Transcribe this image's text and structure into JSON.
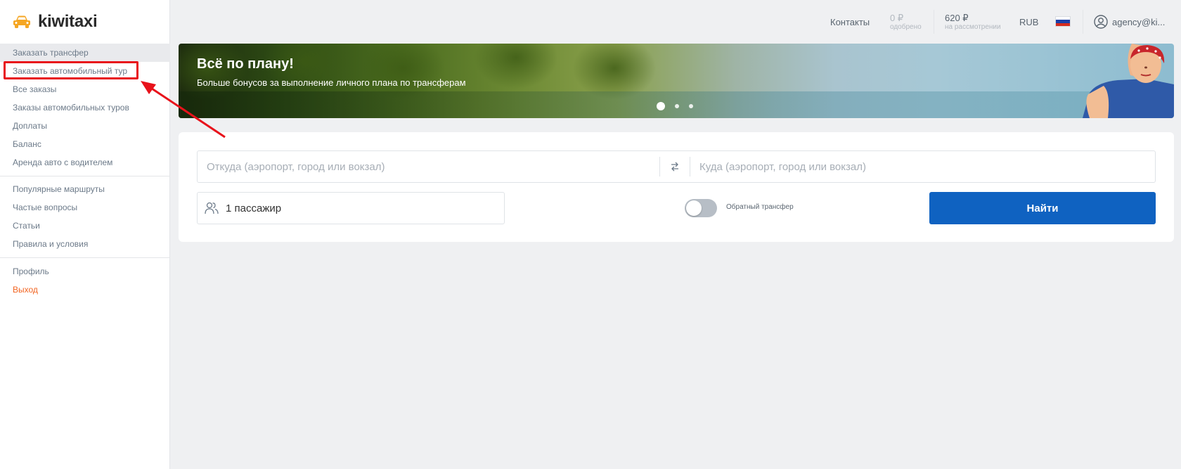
{
  "logo": {
    "text": "kiwitaxi"
  },
  "sidebar": {
    "group1": [
      {
        "label": "Заказать трансфер",
        "active": true
      },
      {
        "label": "Заказать автомобильный тур",
        "highlighted": true
      },
      {
        "label": "Все заказы"
      },
      {
        "label": "Заказы автомобильных туров"
      },
      {
        "label": "Доплаты"
      },
      {
        "label": "Баланс"
      },
      {
        "label": "Аренда авто с водителем"
      }
    ],
    "group2": [
      {
        "label": "Популярные маршруты"
      },
      {
        "label": "Частые вопросы"
      },
      {
        "label": "Статьи"
      },
      {
        "label": "Правила и условия"
      }
    ],
    "group3": [
      {
        "label": "Профиль"
      },
      {
        "label": "Выход"
      }
    ]
  },
  "header": {
    "contacts": "Контакты",
    "approved_amount": "0 ₽",
    "approved_label": "одобрено",
    "pending_amount": "620 ₽",
    "pending_label": "на рассмотрении",
    "currency": "RUB",
    "language_flag": "russia-flag",
    "account": "agency@ki..."
  },
  "banner": {
    "title": "Всё по плану!",
    "subtitle": "Больше бонусов за выполнение личного плана по трансферам",
    "slides": 3,
    "active_slide": 1
  },
  "search": {
    "from_placeholder": "Откуда (аэропорт, город или вокзал)",
    "to_placeholder": "Куда (аэропорт, город или вокзал)",
    "passengers": "1 пассажир",
    "return_transfer_label": "Обратный трансфер",
    "return_transfer_on": false,
    "find_button": "Найти"
  },
  "colors": {
    "accent": "#0f62c1",
    "logo": "#f5a623",
    "logout": "#f26522",
    "annotation": "#e8121b"
  }
}
